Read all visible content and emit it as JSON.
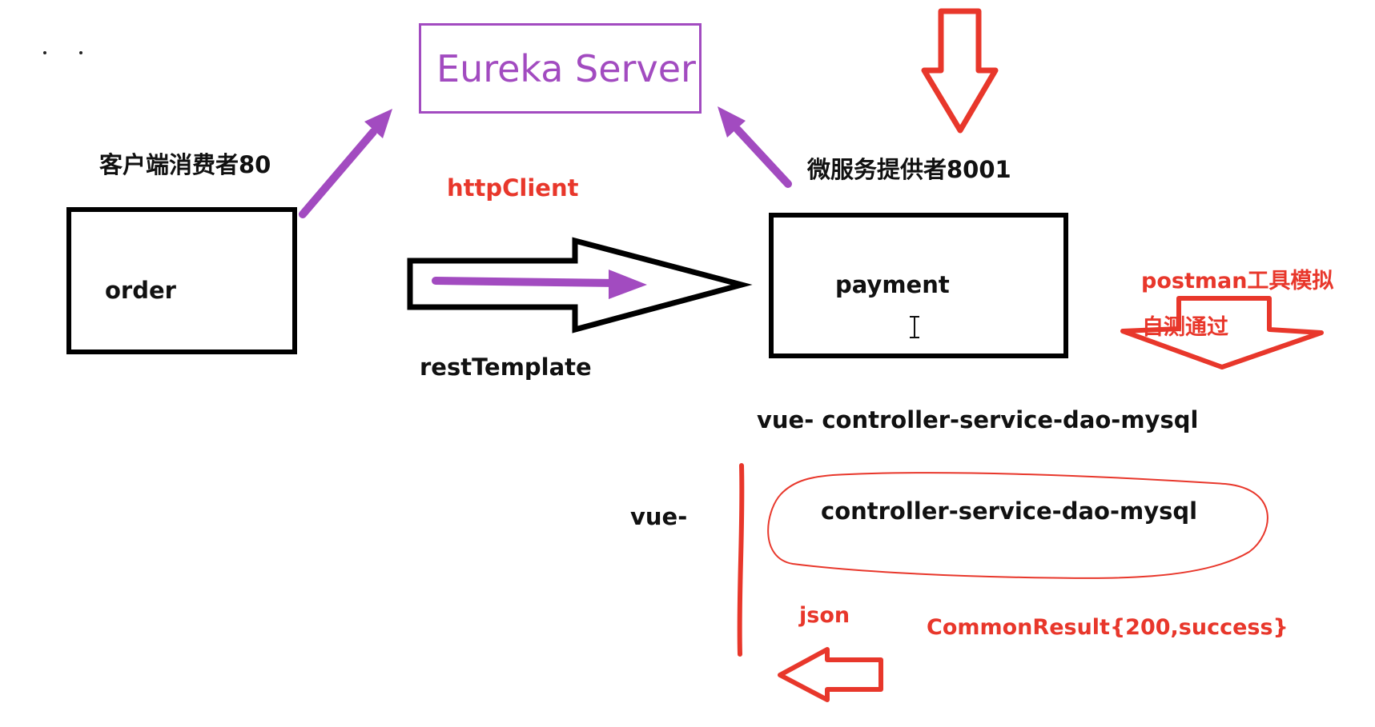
{
  "diagram": {
    "eureka_server": {
      "label": "Eureka Server"
    },
    "consumer": {
      "title": "客户端消费者80",
      "box_label": "order"
    },
    "provider": {
      "title": "微服务提供者8001",
      "box_label": "payment"
    },
    "call": {
      "upper_label": "httpClient",
      "lower_label": "restTemplate"
    },
    "postman": {
      "line1": "postman工具模拟",
      "line2": "自测通过"
    },
    "layers": {
      "full": "vue- controller-service-dao-mysql",
      "frontend": "vue-",
      "backend": "controller-service-dao-mysql"
    },
    "response": {
      "format": "json",
      "result": "CommonResult{200,success}"
    },
    "colors": {
      "arrow_purple": "#a24bc0",
      "annotation_red": "#e8372b",
      "outline_black": "#000000"
    }
  }
}
